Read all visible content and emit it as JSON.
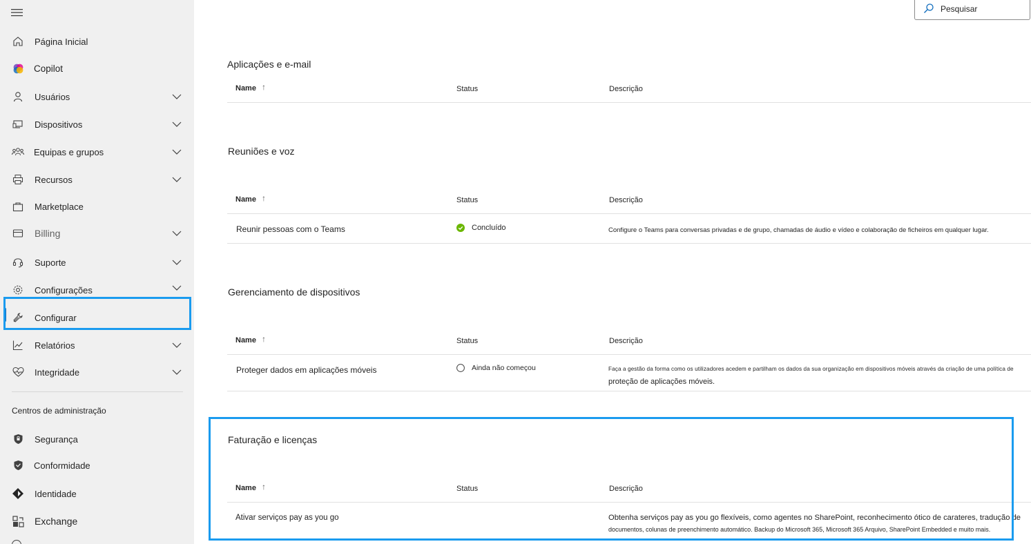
{
  "search": {
    "label": "Pesquisar"
  },
  "sidebar": {
    "items": [
      {
        "label": "Página Inicial",
        "icon": "home-icon",
        "chevron": false
      },
      {
        "label": "Copilot",
        "icon": "copilot-icon",
        "chevron": false
      },
      {
        "label": "Usuários",
        "icon": "user-icon",
        "chevron": true
      },
      {
        "label": "Dispositivos",
        "icon": "devices-icon",
        "chevron": true
      },
      {
        "label": "Equipas e grupos",
        "icon": "people-team-icon",
        "chevron": true
      },
      {
        "label": "Recursos",
        "icon": "printer-icon",
        "chevron": true
      },
      {
        "label": "Marketplace",
        "icon": "shopping-bag-icon",
        "chevron": false
      },
      {
        "label": "Billing",
        "icon": "credit-card-icon",
        "chevron": true
      },
      {
        "label": "Suporte",
        "icon": "headset-icon",
        "chevron": true
      },
      {
        "label": "Configurações",
        "icon": "gear-icon",
        "chevron": true
      },
      {
        "label": "Configurar",
        "icon": "wrench-icon",
        "chevron": false,
        "active": true
      },
      {
        "label": "Relatórios",
        "icon": "line-chart-icon",
        "chevron": true
      },
      {
        "label": "Integridade",
        "icon": "heart-pulse-icon",
        "chevron": true
      }
    ],
    "admin_centers_title": "Centros de administração",
    "admin_centers": [
      {
        "label": "Segurança",
        "icon": "shield-icon"
      },
      {
        "label": "Conformidade",
        "icon": "shield-check-icon"
      },
      {
        "label": "Identidade",
        "icon": "identity-diamond-icon"
      },
      {
        "label": "Exchange",
        "icon": "exchange-icon"
      }
    ]
  },
  "columns": {
    "name": "Name",
    "status": "Status",
    "description": "Descrição"
  },
  "sections": [
    {
      "title": "Aplicações e e-mail",
      "rows": []
    },
    {
      "title": "Reuniões e voz",
      "rows": [
        {
          "name": "Reunir pessoas com o Teams",
          "status": "Concluído",
          "status_kind": "done",
          "description": "Configure o Teams para conversas privadas e de grupo, chamadas de áudio e vídeo e colaboração de ficheiros em qualquer lugar."
        }
      ]
    },
    {
      "title": "Gerenciamento de dispositivos",
      "rows": [
        {
          "name": "Proteger dados em aplicações móveis",
          "status": "Ainda não começou",
          "status_kind": "not-started",
          "description_line1": "Faça a gestão da forma como os utilizadores acedem e partilham os dados da sua organização em dispositivos móveis através da criação de uma política de",
          "description_line2": "proteção de aplicações móveis."
        }
      ]
    },
    {
      "title": "Faturação e licenças",
      "rows": [
        {
          "name": "Ativar serviços pay as you go",
          "status": "",
          "description_line1": "Obtenha serviços pay as you go flexíveis, como agentes no SharePoint, reconhecimento ótico de carateres, tradução de",
          "description_line2": "documentos, colunas de preenchimento automático. Backup do Microsoft 365, Microsoft 365 Arquivo, SharePoint Embedded e muito mais."
        }
      ]
    }
  ],
  "colors": {
    "highlight": "#1a9bef",
    "done": "#6bb700",
    "sidebar_bg": "#f0f0f0"
  }
}
